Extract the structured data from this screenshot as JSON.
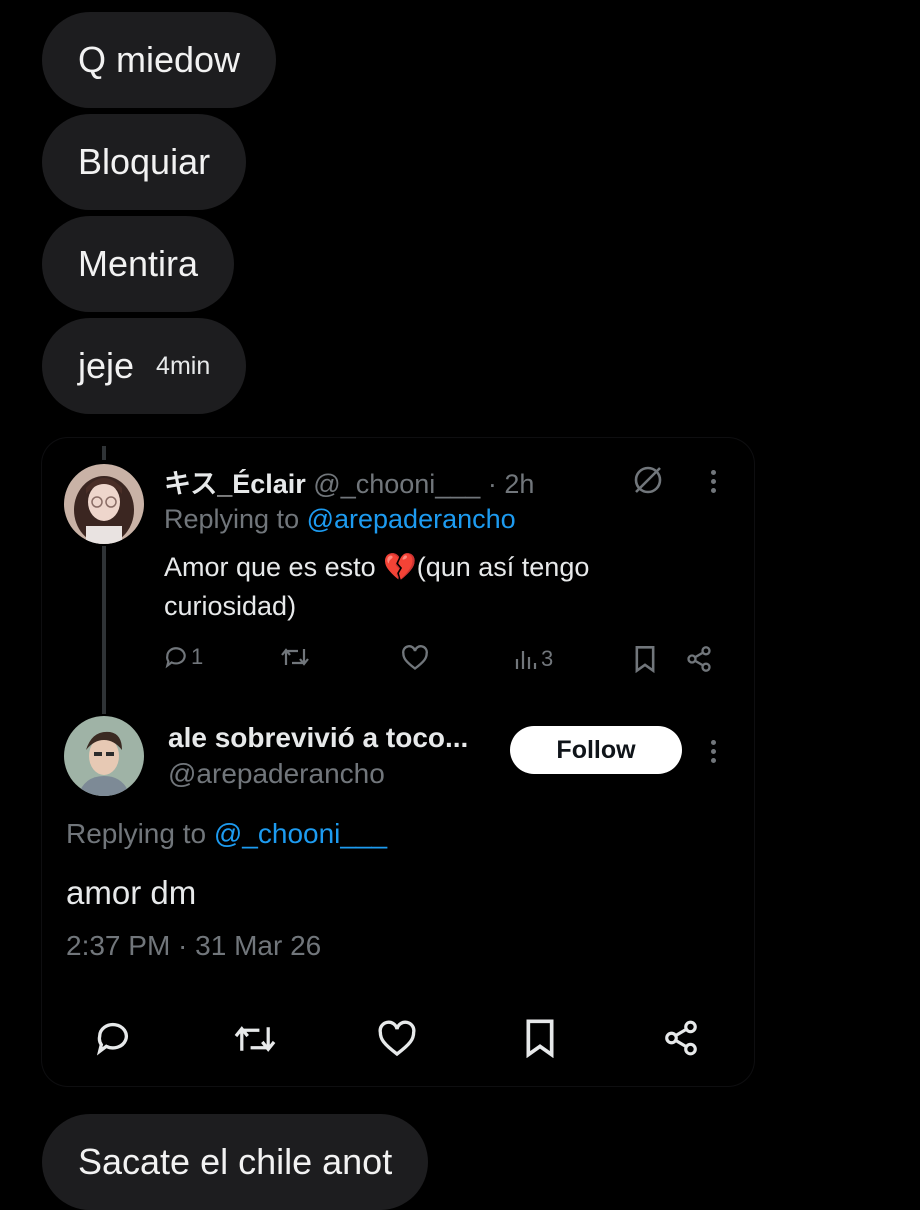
{
  "messages": [
    {
      "text": "Q miedow"
    },
    {
      "text": "Bloquiar"
    },
    {
      "text": "Mentira"
    },
    {
      "text": "jeje",
      "time": "4min"
    }
  ],
  "quoted_tweet": {
    "display_name": "キス_Éclair",
    "handle": "@_chooni___",
    "time": "· 2h",
    "replying_prefix": "Replying to ",
    "replying_to": "@arepaderancho",
    "text": "Amor que es esto 💔(qun así tengo curiosidad)",
    "replies": "1",
    "views": "3"
  },
  "reply_tweet": {
    "display_name": "ale sobrevivió a toco...",
    "handle": "@arepaderancho",
    "follow_label": "Follow",
    "replying_prefix": "Replying to ",
    "replying_to": "@_chooni___",
    "text": "amor dm",
    "timestamp": "2:37 PM · 31 Mar 26"
  },
  "bottom_message": {
    "text": "Sacate el chile anot"
  },
  "colors": {
    "background": "#000000",
    "bubble": "#1d1d1f",
    "link": "#1d9bf0",
    "muted": "#71767b"
  }
}
